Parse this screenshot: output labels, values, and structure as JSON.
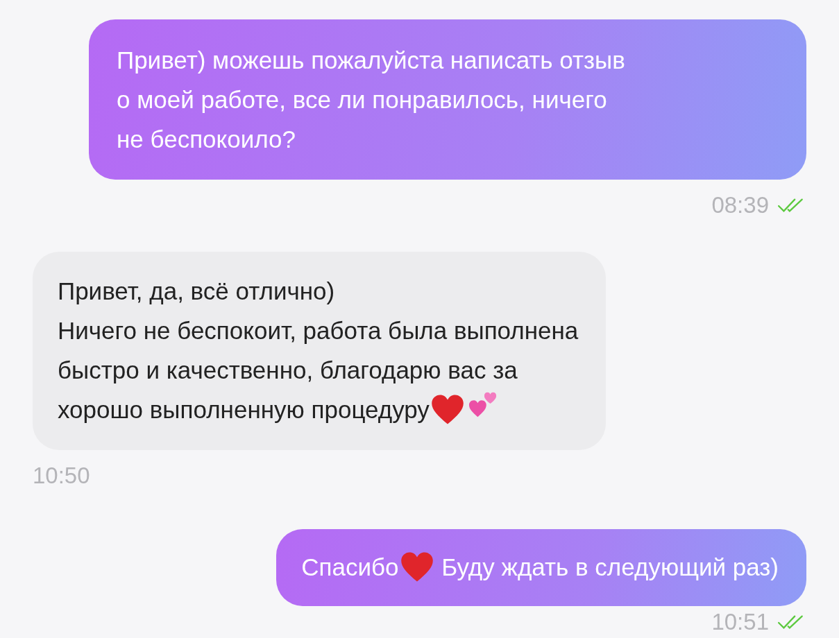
{
  "messages": [
    {
      "kind": "outgoing",
      "lines": [
        [
          {
            "kind": "text",
            "text": "Привет) можешь пожалуйста написать отзыв"
          }
        ],
        [
          {
            "kind": "text",
            "text": "о моей работе, все ли понравилось, ничего"
          }
        ],
        [
          {
            "kind": "text",
            "text": "не беспокоило?"
          }
        ]
      ],
      "time": "08:39",
      "read": true
    },
    {
      "kind": "incoming",
      "lines": [
        [
          {
            "kind": "text",
            "text": "Привет, да, всё отлично)"
          }
        ],
        [
          {
            "kind": "text",
            "text": "Ничего не беспокоит, работа была выполнена"
          }
        ],
        [
          {
            "kind": "text",
            "text": "быстро и качественно, благодарю вас за"
          }
        ],
        [
          {
            "kind": "text",
            "text": "хорошо выполненную процедуру"
          },
          {
            "kind": "heart"
          },
          {
            "kind": "two-hearts"
          }
        ]
      ],
      "time": "10:50"
    },
    {
      "kind": "outgoing",
      "lines": [
        [
          {
            "kind": "text",
            "text": "Спасибо"
          },
          {
            "kind": "heart"
          },
          {
            "kind": "text",
            "text": " Буду ждать в следующий раз)"
          }
        ]
      ],
      "time": "10:51",
      "read": true
    }
  ]
}
